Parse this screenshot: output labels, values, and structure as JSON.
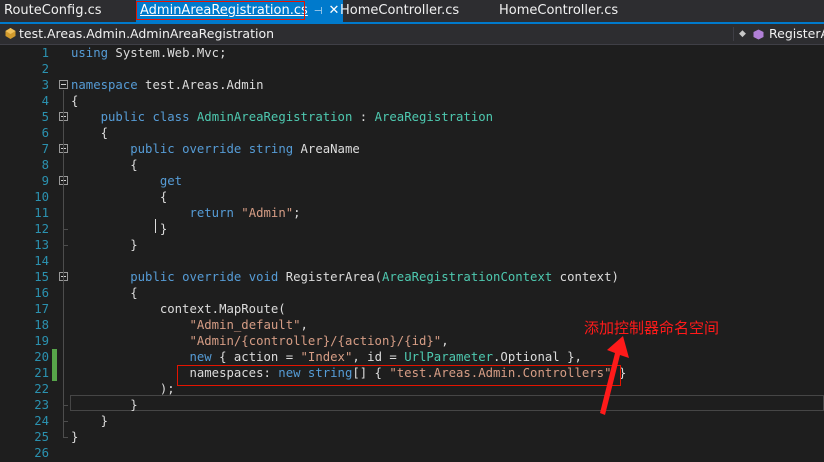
{
  "tabs": [
    {
      "label": "RouteConfig.cs",
      "active": false
    },
    {
      "label": "AdminAreaRegistration.cs",
      "active": true,
      "pin_icon": "pin-icon",
      "close_icon": "close-icon"
    },
    {
      "label": "HomeController.cs",
      "active": false
    },
    {
      "label": "HomeController.cs",
      "active": false
    }
  ],
  "nav": {
    "left": "test.Areas.Admin.AdminAreaRegistration",
    "right": "RegisterA",
    "left_icon": "class-icon",
    "right_icon": "method-icon",
    "dropdown_icon": "dropdown-arrow-icon"
  },
  "colors": {
    "keyword": "#569cd6",
    "type": "#4ec9b0",
    "string": "#d69d85",
    "plain": "#dcdcdc",
    "line_number": "#2b91af",
    "annotation": "#ff1a1a",
    "change_bar": "#57a64a",
    "accent": "#007acc"
  },
  "code_lines": [
    {
      "n": "1",
      "html": "<span class=\"kw\">using</span> System.Web.Mvc;"
    },
    {
      "n": "2",
      "html": ""
    },
    {
      "n": "3",
      "html": "<span class=\"kw\">namespace</span> test.Areas.Admin"
    },
    {
      "n": "4",
      "html": "{"
    },
    {
      "n": "5",
      "html": "    <span class=\"kw\">public</span> <span class=\"kw\">class</span> <span class=\"ty\">AdminAreaRegistration</span> : <span class=\"ty\">AreaRegistration</span>"
    },
    {
      "n": "6",
      "html": "    {"
    },
    {
      "n": "7",
      "html": "        <span class=\"kw\">public</span> <span class=\"kw\">override</span> <span class=\"kw\">string</span> AreaName"
    },
    {
      "n": "8",
      "html": "        {"
    },
    {
      "n": "9",
      "html": "            <span class=\"kw\">get</span>"
    },
    {
      "n": "10",
      "html": "            {"
    },
    {
      "n": "11",
      "html": "                <span class=\"kw\">return</span> <span class=\"st\">\"Admin\"</span>;"
    },
    {
      "n": "12",
      "html": "            }"
    },
    {
      "n": "13",
      "html": "        }"
    },
    {
      "n": "14",
      "html": ""
    },
    {
      "n": "15",
      "html": "        <span class=\"kw\">public</span> <span class=\"kw\">override</span> <span class=\"kw\">void</span> RegisterArea(<span class=\"ty\">AreaRegistrationContext</span> context)"
    },
    {
      "n": "16",
      "html": "        {"
    },
    {
      "n": "17",
      "html": "            context.MapRoute("
    },
    {
      "n": "18",
      "html": "                <span class=\"st\">\"Admin_default\"</span>,"
    },
    {
      "n": "19",
      "html": "                <span class=\"st\">\"Admin/{controller}/{action}/{id}\"</span>,"
    },
    {
      "n": "20",
      "html": "                <span class=\"kw\">new</span> { action = <span class=\"st\">\"Index\"</span>, id = <span class=\"ty\">UrlParameter</span>.Optional },"
    },
    {
      "n": "21",
      "html": "                namespaces: <span class=\"kw\">new</span> <span class=\"kw\">string</span>[] { <span class=\"st\">\"test.Areas.Admin.Controllers\"</span> }"
    },
    {
      "n": "22",
      "html": "            );"
    },
    {
      "n": "23",
      "html": "        }"
    },
    {
      "n": "24",
      "html": "    }"
    },
    {
      "n": "25",
      "html": "}"
    },
    {
      "n": "26",
      "html": ""
    }
  ],
  "annotation": {
    "text": "添加控制器命名空间",
    "arrow_icon": "red-arrow-icon"
  }
}
